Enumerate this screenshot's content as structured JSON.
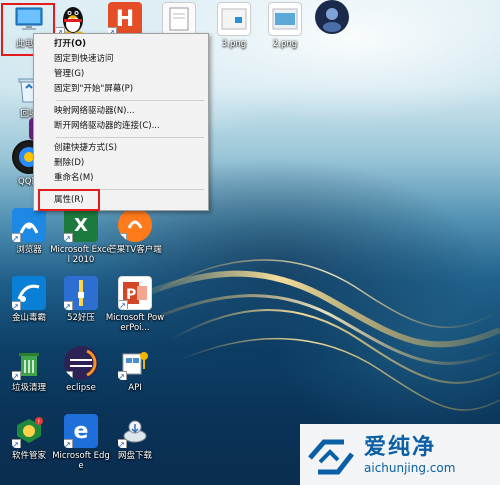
{
  "desktop_icons": [
    {
      "id": "this-pc",
      "label": "此电脑",
      "icon": "computer-icon"
    },
    {
      "id": "qq-top",
      "label": "",
      "icon": "qq-penguin-icon"
    },
    {
      "id": "html",
      "label": "",
      "icon": "html5-icon"
    },
    {
      "id": "file-note",
      "label": "",
      "icon": "document-icon"
    },
    {
      "id": "png3",
      "label": "3.png",
      "icon": "image-file-icon"
    },
    {
      "id": "png2",
      "label": "2.png",
      "icon": "image-file-icon"
    },
    {
      "id": "avatar-app",
      "label": "",
      "icon": "app-avatar-icon"
    },
    {
      "id": "recycle",
      "label": "回收",
      "icon": "recycle-bin-icon"
    },
    {
      "id": "vs",
      "label": "",
      "icon": "visual-studio-icon"
    },
    {
      "id": "qqvideo",
      "label": "QQ影",
      "icon": "qq-video-icon"
    },
    {
      "id": "browser",
      "label": "浏览器",
      "icon": "browser-icon"
    },
    {
      "id": "excel",
      "label": "Microsoft Excel 2010",
      "icon": "excel-icon"
    },
    {
      "id": "mgtv",
      "label": "芒果TV客户端",
      "icon": "mango-tv-icon"
    },
    {
      "id": "kingsoft",
      "label": "金山毒霸",
      "icon": "kingsoft-antivirus-icon"
    },
    {
      "id": "zip",
      "label": "52好压",
      "icon": "zip-archive-icon"
    },
    {
      "id": "ppt",
      "label": "Microsoft PowerPoi...",
      "icon": "powerpoint-icon"
    },
    {
      "id": "cleanup",
      "label": "垃圾清理",
      "icon": "trash-cleaner-icon"
    },
    {
      "id": "eclipse",
      "label": "eclipse",
      "icon": "eclipse-icon"
    },
    {
      "id": "api",
      "label": "API",
      "icon": "api-icon"
    },
    {
      "id": "software",
      "label": "软件管家",
      "icon": "software-manager-icon"
    },
    {
      "id": "edge",
      "label": "Microsoft Edge",
      "icon": "edge-icon"
    },
    {
      "id": "netdisk",
      "label": "网盘下载",
      "icon": "cloud-download-icon"
    }
  ],
  "context_menu": {
    "items": [
      {
        "label": "打开(O)",
        "bold": true
      },
      {
        "label": "固定到快速访问"
      },
      {
        "label": "管理(G)"
      },
      {
        "label": "固定到\"开始\"屏幕(P)"
      },
      {
        "separator": true
      },
      {
        "label": "映射网络驱动器(N)..."
      },
      {
        "label": "断开网络驱动器的连接(C)..."
      },
      {
        "separator": true
      },
      {
        "label": "创建快捷方式(S)"
      },
      {
        "label": "删除(D)"
      },
      {
        "label": "重命名(M)"
      },
      {
        "separator": true
      },
      {
        "label": "属性(R)"
      }
    ]
  },
  "watermark": {
    "brand": "爱纯净",
    "url": "aichunjing.com"
  },
  "colors": {
    "highlight_border": "#e31b1b",
    "watermark_blue": "#0b5fa5"
  }
}
